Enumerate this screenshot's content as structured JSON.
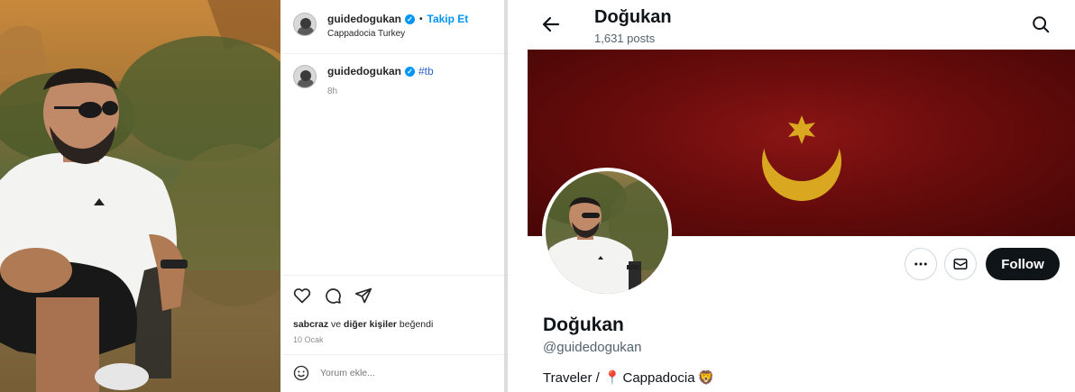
{
  "instagram": {
    "username": "guidedogukan",
    "follow_label": "Takip Et",
    "dot": "•",
    "location": "Cappadocia Turkey",
    "caption": {
      "username": "guidedogukan",
      "text": "#tb",
      "time": "8h"
    },
    "likes": {
      "user": "sabcraz",
      "connector": "ve",
      "others": "diğer kişiler",
      "suffix": "beğendi"
    },
    "date": "10 Ocak",
    "comment_placeholder": "Yorum ekle..."
  },
  "twitter": {
    "title": "Doğukan",
    "post_count": "1,631 posts",
    "follow_label": "Follow",
    "name": "Doğukan",
    "handle": "@guidedogukan",
    "bio_text": "Traveler /",
    "bio_place": "Cappadocia",
    "bio_pin": "📍",
    "bio_emoji": "🦁"
  },
  "colors": {
    "ig_link": "#0095f6",
    "tw_follow_bg": "#0f1419",
    "banner_red": "#6a0c0c",
    "crescent_gold": "#d9a820"
  }
}
